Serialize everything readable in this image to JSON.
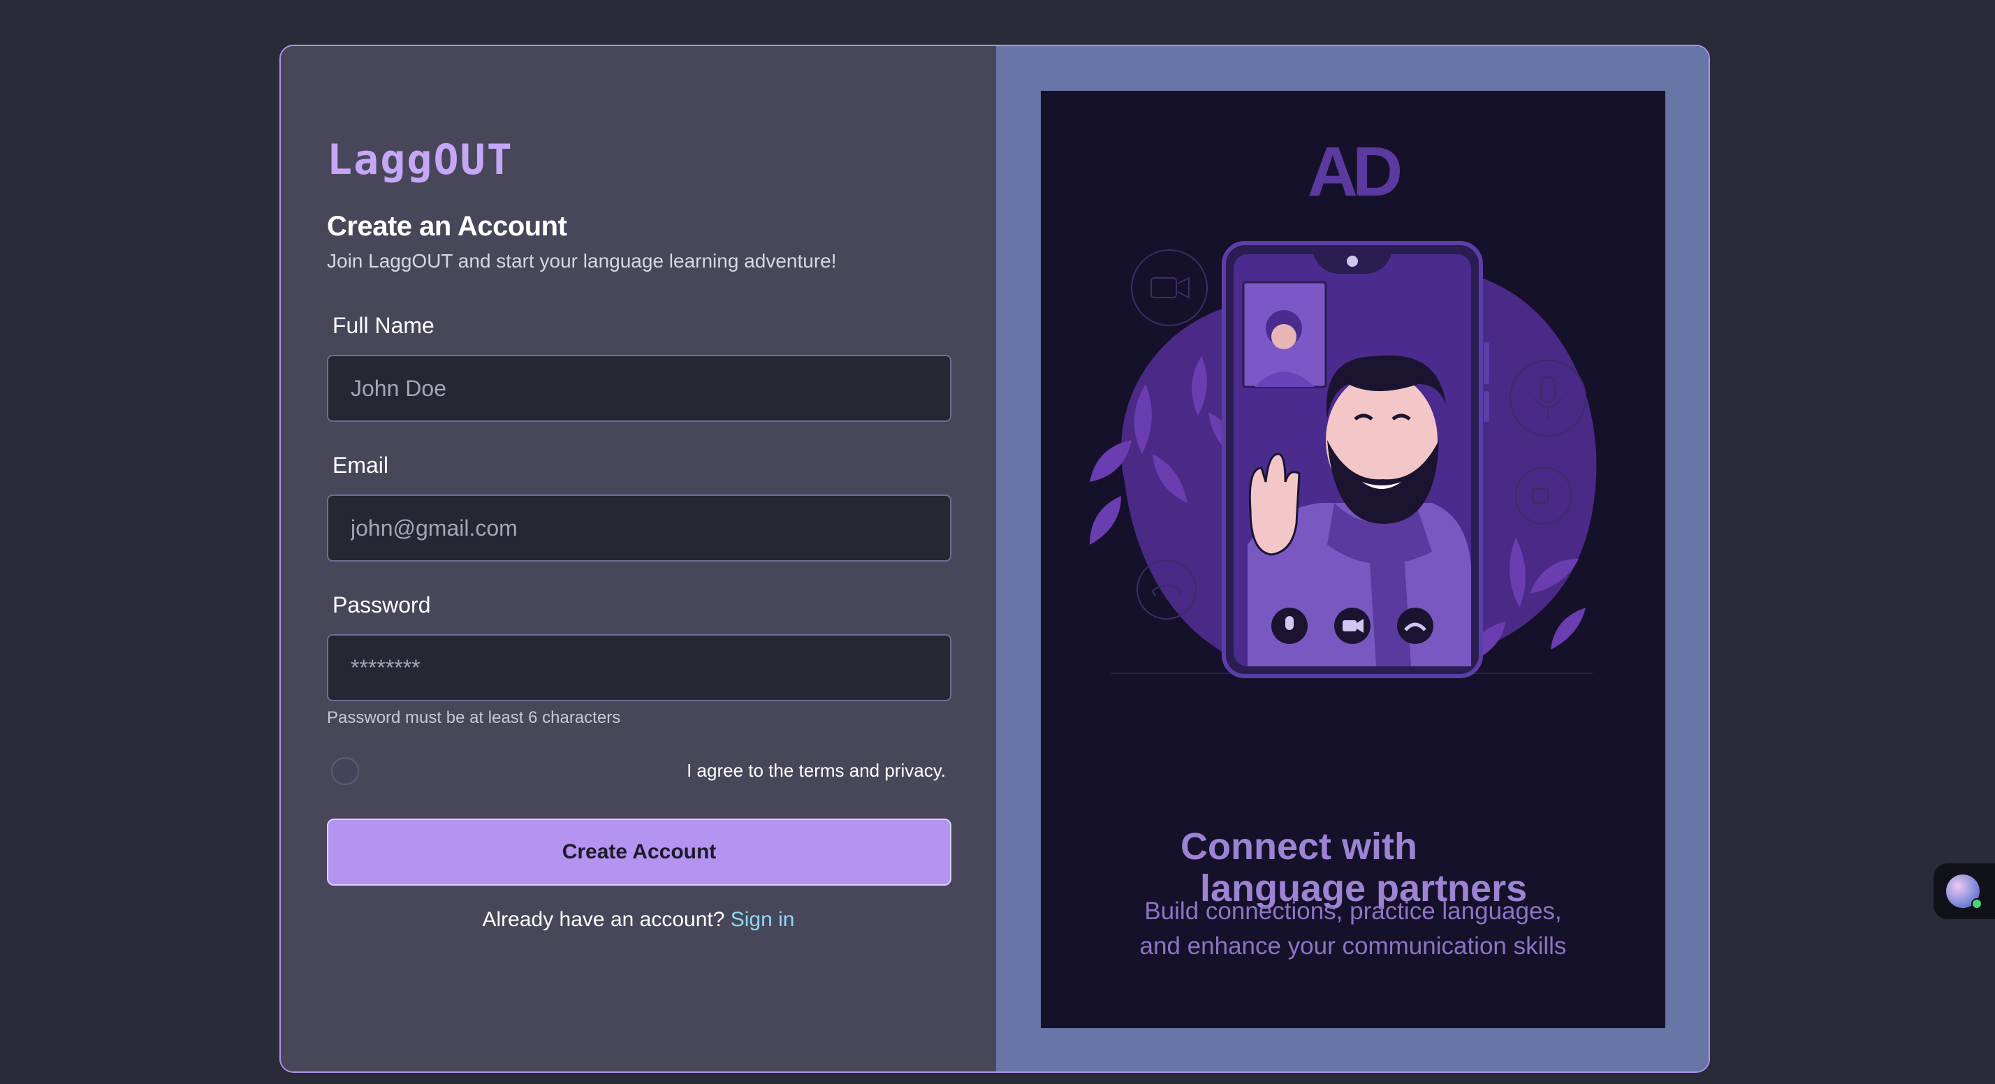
{
  "brand": "LaggOUT",
  "form": {
    "title": "Create an Account",
    "subtitle": "Join LaggOUT and start your language learning adventure!",
    "full_name_label": "Full Name",
    "full_name_placeholder": "John Doe",
    "email_label": "Email",
    "email_placeholder": "john@gmail.com",
    "password_label": "Password",
    "password_placeholder": "********",
    "password_hint": "Password must be at least 6 characters",
    "agree_label": "I agree to the terms and privacy.",
    "agree_checked": false,
    "submit_label": "Create Account",
    "signin_prompt": "Already have an account?",
    "signin_link": "Sign in"
  },
  "promo": {
    "logo_text": "AD",
    "title_line1": "Connect with",
    "title_line2": "language partners",
    "subtitle_line1": "Build connections, practice languages,",
    "subtitle_line2": "and enhance your communication skills"
  },
  "colors": {
    "page_bg": "#2a2b38",
    "form_panel": "#474759",
    "promo_panel": "#6776a6",
    "promo_bg": "#16112a",
    "accent": "#b493f1",
    "link": "#8fd8f2"
  },
  "icons": [
    "video-camera-icon",
    "microphone-icon",
    "phone-hangup-icon",
    "assistant-avatar-icon"
  ]
}
